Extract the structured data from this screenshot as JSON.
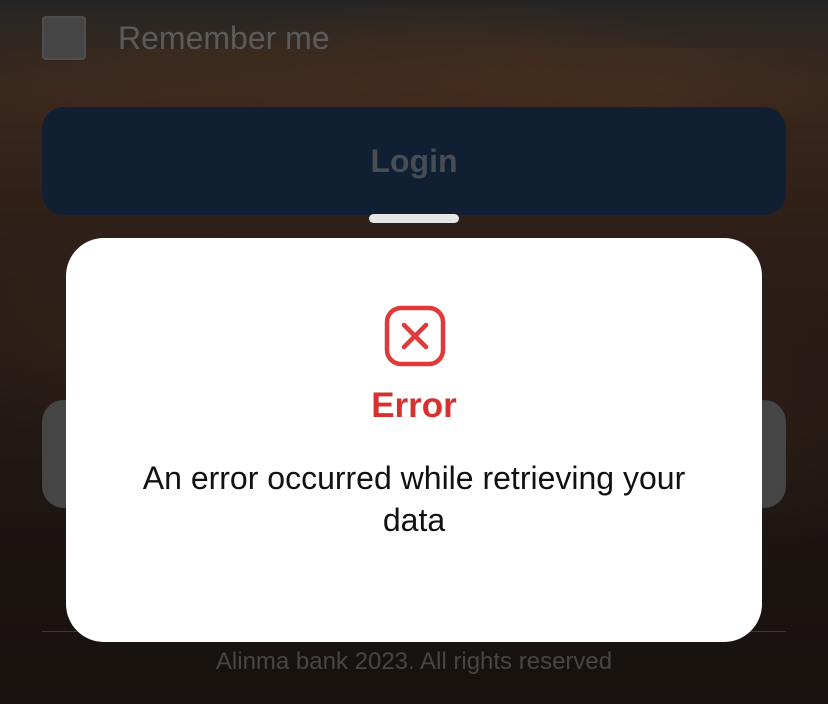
{
  "login_form": {
    "remember_label": "Remember me",
    "login_label": "Login"
  },
  "footer": {
    "copyright": "Alinma bank 2023. All rights reserved"
  },
  "error_dialog": {
    "icon": "error-x-icon",
    "title": "Error",
    "message": "An error occurred while retrieving your data"
  },
  "colors": {
    "error_red": "#d6302f",
    "login_button": "#1b304d"
  }
}
